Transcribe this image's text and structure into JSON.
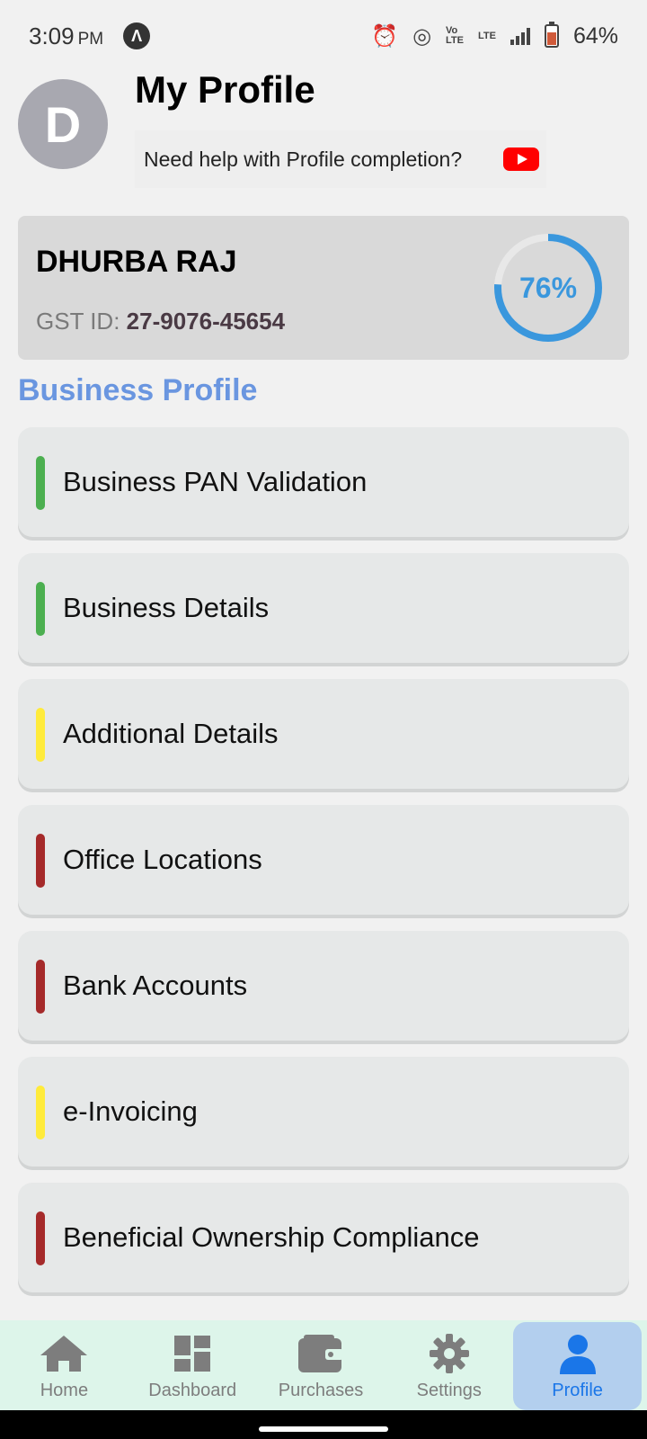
{
  "status": {
    "time": "3:09",
    "ampm": "PM",
    "app_icon": "Λ",
    "lte_label": "Vo LTE",
    "lte2": "LTE",
    "battery": "64%"
  },
  "header": {
    "avatar_letter": "D",
    "title": "My Profile",
    "help_text": "Need help with Profile completion?"
  },
  "profile": {
    "name": "DHURBA RAJ",
    "gst_label": "GST ID:",
    "gst_value": "27-9076-45654",
    "completion_percent": 76,
    "completion_label": "76%"
  },
  "section": {
    "title": "Business Profile"
  },
  "items": [
    {
      "label": "Business PAN Validation",
      "status_color": "#4caf50"
    },
    {
      "label": "Business Details",
      "status_color": "#4caf50"
    },
    {
      "label": "Additional Details",
      "status_color": "#ffeb3b"
    },
    {
      "label": "Office Locations",
      "status_color": "#a52a2a"
    },
    {
      "label": "Bank Accounts",
      "status_color": "#a52a2a"
    },
    {
      "label": "e-Invoicing",
      "status_color": "#ffeb3b"
    },
    {
      "label": "Beneficial Ownership Compliance",
      "status_color": "#a52a2a"
    }
  ],
  "nav": [
    {
      "label": "Home",
      "icon": "home-icon"
    },
    {
      "label": "Dashboard",
      "icon": "dashboard-icon"
    },
    {
      "label": "Purchases",
      "icon": "wallet-icon"
    },
    {
      "label": "Settings",
      "icon": "gear-icon"
    },
    {
      "label": "Profile",
      "icon": "person-icon",
      "active": true
    }
  ],
  "colors": {
    "accent": "#3a97dd",
    "section_title": "#6a96e0",
    "nav_active": "#1a76e8"
  }
}
